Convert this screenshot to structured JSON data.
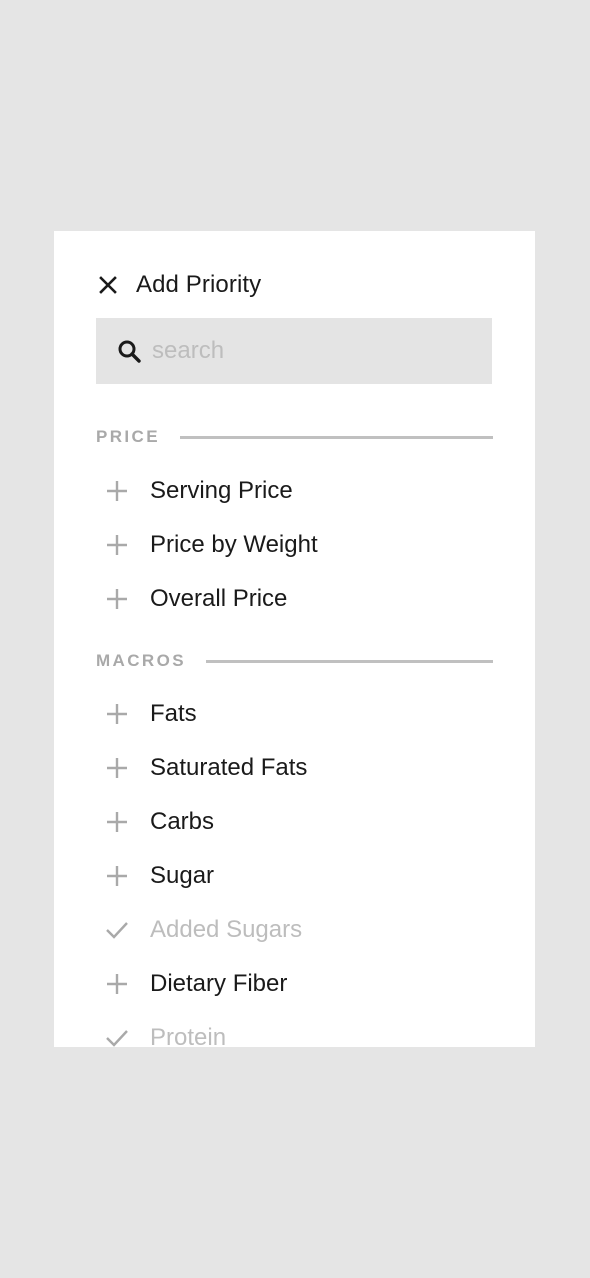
{
  "header": {
    "title": "Add Priority"
  },
  "search": {
    "placeholder": "search",
    "value": ""
  },
  "sections": [
    {
      "label": "PRICE",
      "items": [
        {
          "label": "Serving Price",
          "icon": "plus-icon",
          "added": false
        },
        {
          "label": "Price by Weight",
          "icon": "plus-icon",
          "added": false
        },
        {
          "label": "Overall Price",
          "icon": "plus-icon",
          "added": false
        }
      ]
    },
    {
      "label": "MACROS",
      "items": [
        {
          "label": "Fats",
          "icon": "plus-icon",
          "added": false
        },
        {
          "label": "Saturated Fats",
          "icon": "plus-icon",
          "added": false
        },
        {
          "label": "Carbs",
          "icon": "plus-icon",
          "added": false
        },
        {
          "label": "Sugar",
          "icon": "plus-icon",
          "added": false
        },
        {
          "label": "Added Sugars",
          "icon": "check-icon",
          "added": true
        },
        {
          "label": "Dietary Fiber",
          "icon": "plus-icon",
          "added": false
        },
        {
          "label": "Protein",
          "icon": "check-icon",
          "added": true
        }
      ]
    }
  ],
  "colors": {
    "background": "#e5e5e5",
    "panel": "#ffffff",
    "search_bg": "#e4e4e4",
    "text": "#1a1a1a",
    "muted": "#bdbdbd",
    "section_label": "#a9a9a9"
  }
}
